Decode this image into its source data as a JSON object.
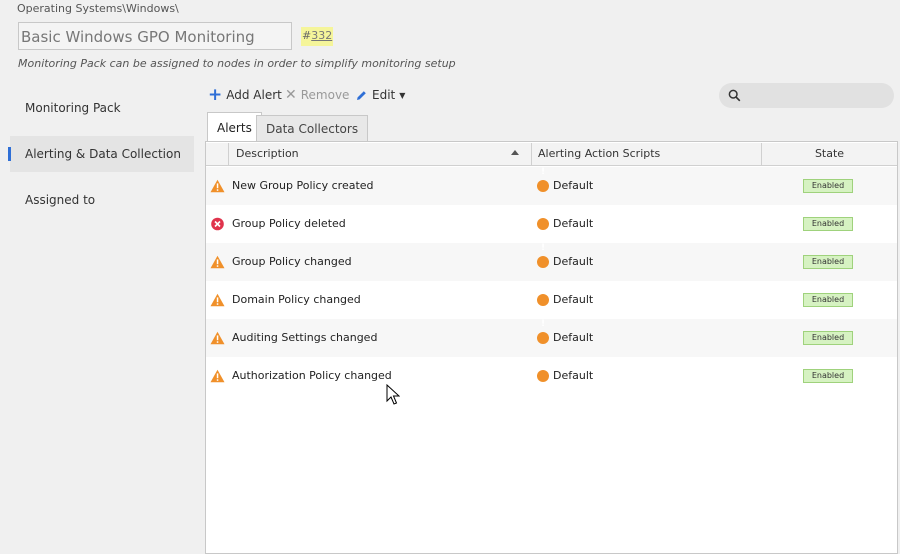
{
  "header": {
    "breadcrumb": "Operating Systems\\Windows\\",
    "pack_name": "Basic Windows GPO Monitoring",
    "pack_id_prefix": "#",
    "pack_id": "332",
    "hint": "Monitoring Pack can be assigned to nodes in order to simplify monitoring setup"
  },
  "sidebar": {
    "items": [
      {
        "label": "Monitoring Pack",
        "active": false
      },
      {
        "label": "Alerting & Data Collection",
        "active": true
      },
      {
        "label": "Assigned to",
        "active": false
      }
    ]
  },
  "toolbar": {
    "add_label": "Add Alert",
    "remove_label": "Remove",
    "edit_label": "Edit",
    "search_placeholder": ""
  },
  "tabs": [
    {
      "label": "Alerts",
      "active": true
    },
    {
      "label": "Data Collectors",
      "active": false
    }
  ],
  "table": {
    "columns": [
      "Description",
      "Alerting Action Scripts",
      "State"
    ],
    "rows": [
      {
        "severity": "warning",
        "description": "New Group Policy created",
        "script": "Default",
        "state": "Enabled"
      },
      {
        "severity": "error",
        "description": "Group Policy deleted",
        "script": "Default",
        "state": "Enabled"
      },
      {
        "severity": "warning",
        "description": "Group Policy changed",
        "script": "Default",
        "state": "Enabled"
      },
      {
        "severity": "warning",
        "description": "Domain Policy changed",
        "script": "Default",
        "state": "Enabled"
      },
      {
        "severity": "warning",
        "description": "Auditing Settings changed",
        "script": "Default",
        "state": "Enabled"
      },
      {
        "severity": "warning",
        "description": "Authorization Policy changed",
        "script": "Default",
        "state": "Enabled"
      }
    ]
  },
  "colors": {
    "accent": "#2f6fd6",
    "warning": "#f0902a",
    "error": "#e0334c",
    "enabled_bg": "#d6f2c2",
    "id_highlight": "#f5f59a"
  },
  "icons": {
    "warning": "warning-triangle-icon",
    "error": "error-circle-icon",
    "script": "script-alert-icon",
    "search": "search-icon",
    "add": "plus-icon",
    "remove": "close-icon",
    "edit": "pencil-icon"
  }
}
